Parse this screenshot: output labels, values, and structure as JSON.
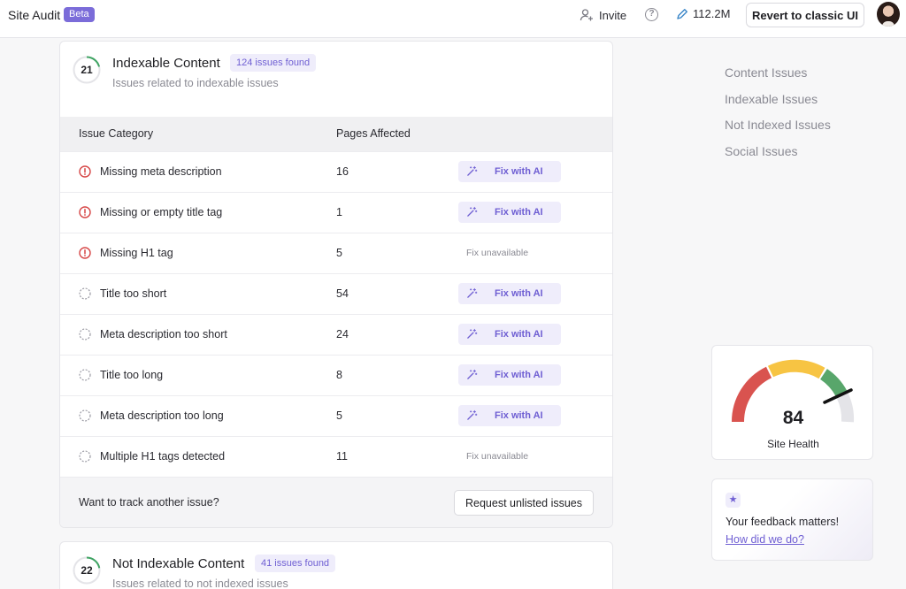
{
  "header": {
    "app_title": "Site Audit",
    "beta_label": "Beta",
    "invite_label": "Invite",
    "help_icon": "question-circle-icon",
    "credits_value": "112.2M",
    "revert_label": "Revert to classic UI"
  },
  "indexable": {
    "score": "21",
    "score_fraction": 0.21,
    "title": "Indexable Content",
    "issues_badge": "124 issues found",
    "subtitle": "Issues related to indexable issues",
    "col_category": "Issue Category",
    "col_pages": "Pages Affected",
    "rows": [
      {
        "name": "Missing meta description",
        "pages": "16",
        "severity": "error",
        "action": "Fix with AI"
      },
      {
        "name": "Missing or empty title tag",
        "pages": "1",
        "severity": "error",
        "action": "Fix with AI"
      },
      {
        "name": "Missing H1 tag",
        "pages": "5",
        "severity": "error",
        "action": "Fix unavailable"
      },
      {
        "name": "Title too short",
        "pages": "54",
        "severity": "warning",
        "action": "Fix with AI"
      },
      {
        "name": "Meta description too short",
        "pages": "24",
        "severity": "warning",
        "action": "Fix with AI"
      },
      {
        "name": "Title too long",
        "pages": "8",
        "severity": "warning",
        "action": "Fix with AI"
      },
      {
        "name": "Meta description too long",
        "pages": "5",
        "severity": "warning",
        "action": "Fix with AI"
      },
      {
        "name": "Multiple H1 tags detected",
        "pages": "11",
        "severity": "warning",
        "action": "Fix unavailable"
      }
    ],
    "footer_question": "Want to track another issue?",
    "request_label": "Request unlisted issues"
  },
  "not_indexable": {
    "score": "22",
    "score_fraction": 0.22,
    "title": "Not Indexable Content",
    "issues_badge": "41 issues found",
    "subtitle": "Issues related to not indexed issues"
  },
  "right_nav": {
    "items": [
      "Content Issues",
      "Indexable Issues",
      "Not Indexed Issues",
      "Social Issues"
    ]
  },
  "site_health": {
    "value": "84",
    "label": "Site Health",
    "colors": {
      "red": "#d9534f",
      "yellow": "#f7c443",
      "green": "#58a66b",
      "gray": "#e4e4e8"
    }
  },
  "feedback": {
    "title": "Your feedback matters!",
    "link": "How did we do?"
  },
  "colors": {
    "accent": "#7b6cd9",
    "error": "#d64545",
    "ring_green": "#3fa463"
  }
}
